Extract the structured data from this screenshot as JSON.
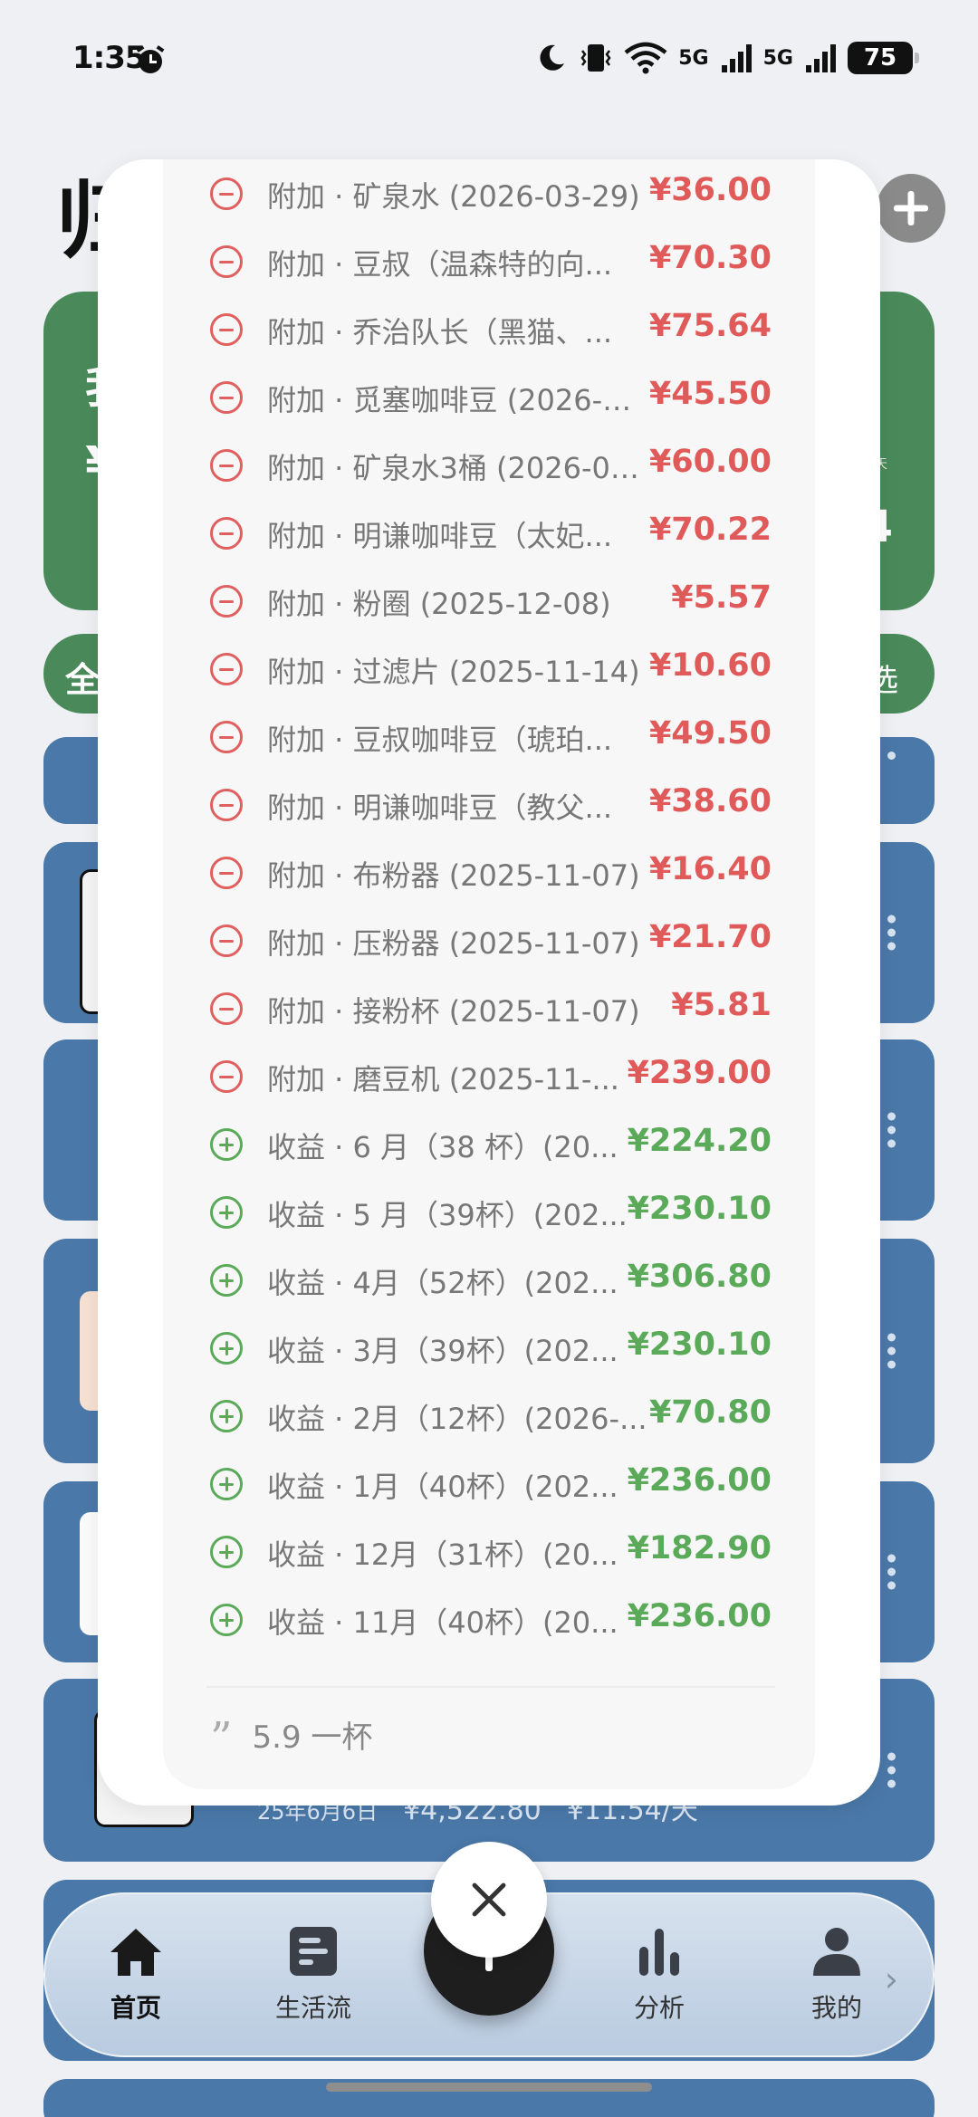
{
  "status_bar": {
    "time": "1:35",
    "net1": "5G",
    "net2": "5G",
    "battery": "75"
  },
  "background": {
    "title": "归",
    "stats_line1": "我",
    "stats_line2": "¥",
    "stats_unit": "/天",
    "stats_value": "4",
    "filter_left": "全",
    "filter_right": "选",
    "card_date": "25年6月6日",
    "card_total": "¥4,522.80",
    "card_daily": "¥11.54/天"
  },
  "modal": {
    "rows": [
      {
        "type": "minus",
        "label": "附加 · 矿泉水 (2026-03-29)",
        "amount": "¥36.00"
      },
      {
        "type": "minus",
        "label": "附加 · 豆叔（温森特的向...",
        "amount": "¥70.30"
      },
      {
        "type": "minus",
        "label": "附加 · 乔治队长（黑猫、...",
        "amount": "¥75.64"
      },
      {
        "type": "minus",
        "label": "附加 · 觅塞咖啡豆 (2026-0...",
        "amount": "¥45.50"
      },
      {
        "type": "minus",
        "label": "附加 · 矿泉水3桶 (2026-01...",
        "amount": "¥60.00"
      },
      {
        "type": "minus",
        "label": "附加 · 明谦咖啡豆（太妃...",
        "amount": "¥70.22"
      },
      {
        "type": "minus",
        "label": "附加 · 粉圈 (2025-12-08)",
        "amount": "¥5.57"
      },
      {
        "type": "minus",
        "label": "附加 · 过滤片 (2025-11-14)",
        "amount": "¥10.60"
      },
      {
        "type": "minus",
        "label": "附加 · 豆叔咖啡豆（琥珀...",
        "amount": "¥49.50"
      },
      {
        "type": "minus",
        "label": "附加 · 明谦咖啡豆（教父...",
        "amount": "¥38.60"
      },
      {
        "type": "minus",
        "label": "附加 · 布粉器 (2025-11-07)",
        "amount": "¥16.40"
      },
      {
        "type": "minus",
        "label": "附加 · 压粉器 (2025-11-07)",
        "amount": "¥21.70"
      },
      {
        "type": "minus",
        "label": "附加 · 接粉杯 (2025-11-07)",
        "amount": "¥5.81"
      },
      {
        "type": "minus",
        "label": "附加 · 磨豆机 (2025-11-...",
        "amount": "¥239.00"
      },
      {
        "type": "plus",
        "label": "收益 · 6 月（38 杯）(20...",
        "amount": "¥224.20"
      },
      {
        "type": "plus",
        "label": "收益 · 5 月（39杯）(202...",
        "amount": "¥230.10"
      },
      {
        "type": "plus",
        "label": "收益 · 4月（52杯）(202...",
        "amount": "¥306.80"
      },
      {
        "type": "plus",
        "label": "收益 · 3月（39杯）(202...",
        "amount": "¥230.10"
      },
      {
        "type": "plus",
        "label": "收益 · 2月（12杯）(2026-...",
        "amount": "¥70.80"
      },
      {
        "type": "plus",
        "label": "收益 · 1月（40杯）(202...",
        "amount": "¥236.00"
      },
      {
        "type": "plus",
        "label": "收益 · 12月（31杯）(20...",
        "amount": "¥182.90"
      },
      {
        "type": "plus",
        "label": "收益 · 11月（40杯）(20...",
        "amount": "¥236.00"
      }
    ],
    "note": "5.9 一杯"
  },
  "nav": {
    "home": "首页",
    "feed": "生活流",
    "analysis": "分析",
    "me": "我的"
  },
  "colors": {
    "minus": "#e05a5a",
    "plus": "#5aaa5a",
    "stats_bg": "#4a8a5a",
    "card_bg": "#4a78a8"
  }
}
